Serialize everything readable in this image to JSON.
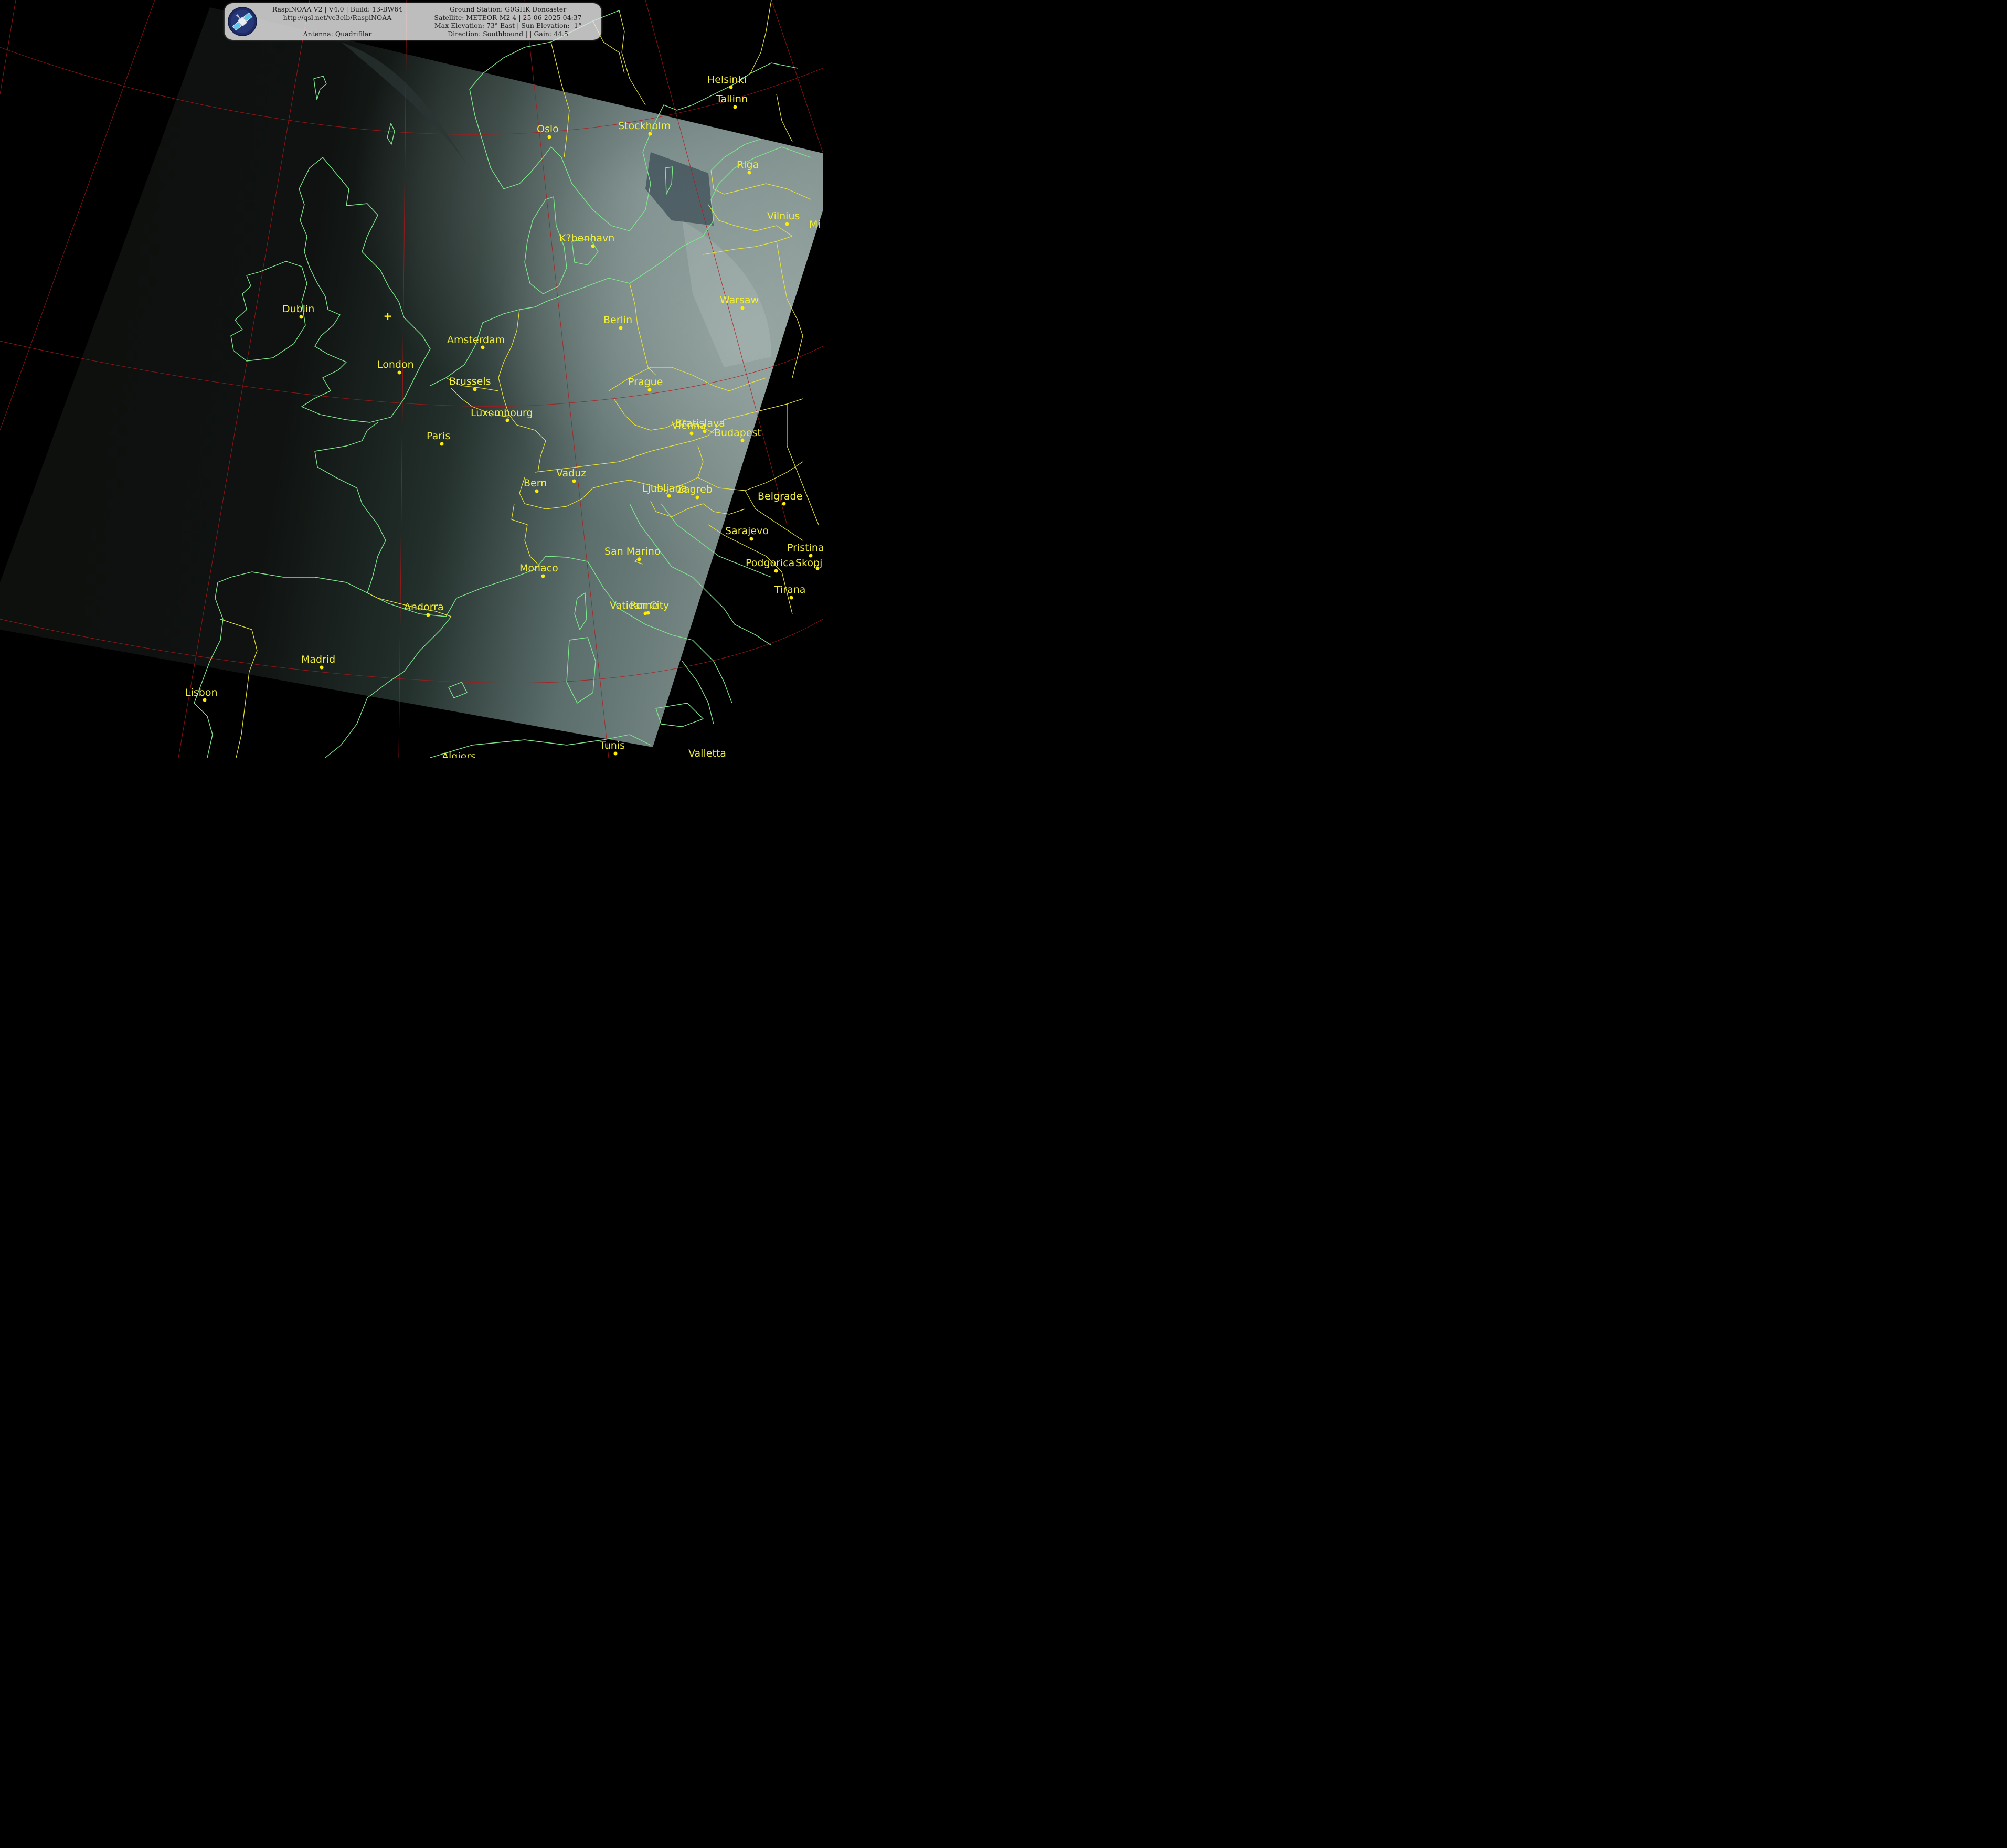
{
  "header": {
    "left_lines": [
      "RaspiNOAA V2 | V4.0 | Build: 13-BW64",
      "http://qsl.net/ve3elb/RaspiNOAA",
      "-----------------------------------------",
      "Antenna: Quadrifilar"
    ],
    "right_lines": [
      "Ground Station: G0GHK Doncaster",
      "Satellite: METEOR-M2 4 | 25-06-2025 04:37",
      "Max Elevation: 73° East | Sun Elevation: -1°",
      "Direction: Southbound | | Gain: 44.5"
    ],
    "logo_icon": "satellite-icon"
  },
  "colors": {
    "coastline": "#7ee68c",
    "border": "#e8e23a",
    "graticule": "#b01818",
    "city_label": "#f2ef3a",
    "city_dot": "#ffee00"
  },
  "map": {
    "ground_station_marker": "+",
    "cities": [
      "Helsinki",
      "Tallinn",
      "Oslo",
      "Stockholm",
      "Riga",
      "Vilnius",
      "Mi",
      "K?benhavn",
      "Dublin",
      "Amsterdam",
      "Berlin",
      "Warsaw",
      "London",
      "Brussels",
      "Prague",
      "Luxembourg",
      "Paris",
      "Vienna",
      "Bratislava",
      "Budapest",
      "Bern",
      "Vaduz",
      "Ljubljana",
      "Zagreb",
      "Belgrade",
      "Sarajevo",
      "San Marino",
      "Monaco",
      "Pristina",
      "Podgorica",
      "Skopje",
      "Tirana",
      "Andorra",
      "Vatican City",
      "Rome",
      "Madrid",
      "Lisbon",
      "Tunis",
      "Valletta",
      "Algiers"
    ]
  }
}
